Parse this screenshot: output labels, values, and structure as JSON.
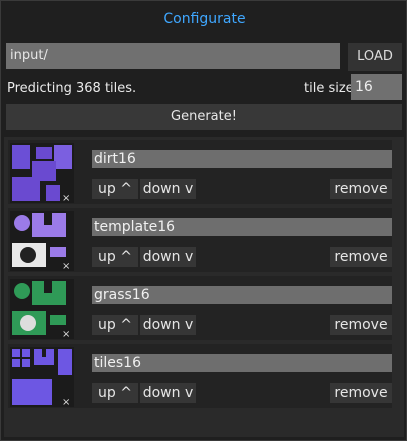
{
  "header": {
    "title": "Configurate"
  },
  "path": {
    "value": "input/",
    "load_label": "LOAD"
  },
  "status": {
    "predict_text": "Predicting 368 tiles.",
    "tile_size_label": "tile size:",
    "tile_size_value": "16"
  },
  "generate_label": "Generate!",
  "tilesets": [
    {
      "name": "dirt16",
      "color": "#6a4ad0",
      "up_label": "up ^",
      "down_label": "down v",
      "remove_label": "remove"
    },
    {
      "name": "template16",
      "color": "#9b7be8",
      "up_label": "up ^",
      "down_label": "down v",
      "remove_label": "remove"
    },
    {
      "name": "grass16",
      "color": "#2f9a57",
      "up_label": "up ^",
      "down_label": "down v",
      "remove_label": "remove"
    },
    {
      "name": "tiles16",
      "color": "#6d57e3",
      "up_label": "up ^",
      "down_label": "down v",
      "remove_label": "remove"
    }
  ]
}
